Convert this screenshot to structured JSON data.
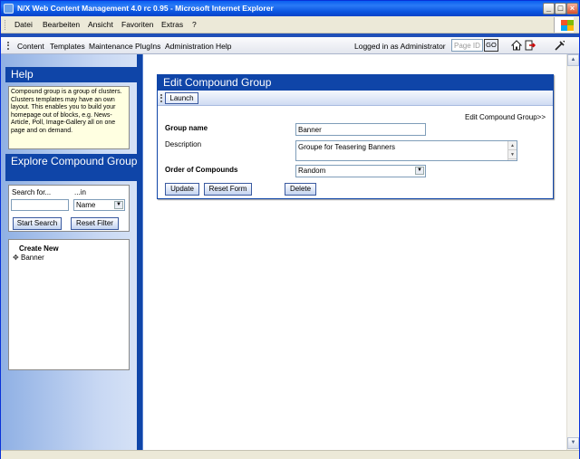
{
  "window": {
    "title": "N/X Web Content Management 4.0 rc 0.95 - Microsoft Internet Explorer",
    "min_glyph": "_",
    "max_glyph": "□",
    "close_glyph": "×"
  },
  "menubar": {
    "items": [
      "Datei",
      "Bearbeiten",
      "Ansicht",
      "Favoriten",
      "Extras",
      "?"
    ]
  },
  "navbar": {
    "items": [
      "Content",
      "Templates",
      "Maintenance",
      "PlugIns",
      "Administration",
      "Help"
    ],
    "logged_in": "Logged in as Administrator",
    "page_id_placeholder": "Page ID",
    "go_label": "GO"
  },
  "sidebar": {
    "help_title": "Help",
    "help_text": "Compound group is a group of clusters. Clusters templates may have an own layout. This enables you to build your homepage out of blocks, e.g. News-Article, Poll, Image-Gallery all on one page and on demand.",
    "explore_title": "Explore Compound Group",
    "search_for_label": "Search for...",
    "in_label": "...in",
    "in_select_value": "Name",
    "start_search_label": "Start Search",
    "reset_filter_label": "Reset Filter",
    "create_new_title": "Create New",
    "create_items": [
      "Banner"
    ]
  },
  "panel": {
    "title": "Edit Compound Group",
    "launch_label": "Launch",
    "breadcrumb_link": "Edit Compound Group>>",
    "group_name_label": "Group name",
    "group_name_value": "Banner",
    "description_label": "Description",
    "description_value": "Groupe for Teasering Banners",
    "order_label": "Order of Compounds",
    "order_value": "Random",
    "update_label": "Update",
    "reset_form_label": "Reset Form",
    "delete_label": "Delete"
  }
}
